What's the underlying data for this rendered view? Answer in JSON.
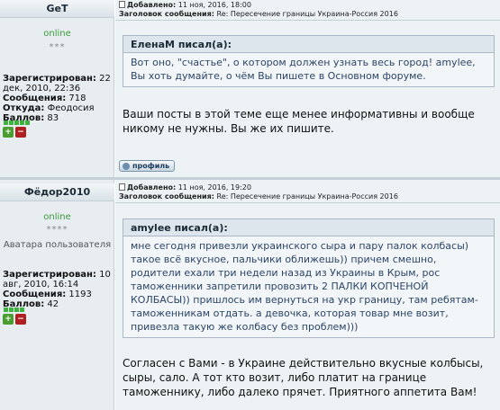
{
  "posts": [
    {
      "username": "GeT",
      "status": "online",
      "rank_stars": "***",
      "registered_label": "Зарегистрирован:",
      "registered_value": "22 дек, 2010, 22:36",
      "messages_label": "Сообщения:",
      "messages_value": "718",
      "from_label": "Откуда:",
      "from_value": "Феодосия",
      "points_label": "Баллов:",
      "points_value": "83",
      "added_label": "Добавлено:",
      "added_value": "11 ноя, 2016, 18:00",
      "subject_label": "Заголовок сообщения:",
      "subject_value": "Re: Пересечение границы Украина-Россия 2016",
      "quote_author": "ЕленаМ писал(а):",
      "quote_text": "Вот оно, \"счастье\", о котором должен узнать весь город! amylee, Вы хоть думайте, о чём Вы пишете в Основном форуме.",
      "text": "Ваши посты в этой теме еще менее информативны и вообще никому не нужны. Вы же их пишите.",
      "profile_label": "профиль"
    },
    {
      "username": "Фёдор2010",
      "status": "online",
      "rank_stars": "****",
      "avatar_alt": "Аватара пользователя",
      "registered_label": "Зарегистрирован:",
      "registered_value": "10 авг, 2010, 16:14",
      "messages_label": "Сообщения:",
      "messages_value": "1193",
      "points_label": "Баллов:",
      "points_value": "42",
      "added_label": "Добавлено:",
      "added_value": "11 ноя, 2016, 19:20",
      "subject_label": "Заголовок сообщения:",
      "subject_value": "Re: Пересечение границы Украина-Россия 2016",
      "quote_author": "amylee писал(а):",
      "quote_text": "мне сегодня привезли украинского сыра и пару палок колбасы) такое всё вкусное, пальчики оближешь)) причем смешно, родители ехали три недели назад из Украины в Крым, рос таможенники запретили провозить 2 ПАЛКИ КОПЧЕНОЙ КОЛБАСЫ)) пришлось им вернуться на укр границу, там ребятам-таможенникам отдать. а девочка, которая товар мне возит, привезла такую же колбасу без проблем)))",
      "text": "Согласен с Вами - в Украине действительно вкусные колбысы, сыры, сало. А тот кто возит, либо платит на границе таможеннику, либо далеко прячет. Приятного аппетита Вам!"
    }
  ],
  "colors": {
    "online": "#3a9a3a",
    "quote_text": "#2a4466",
    "rep_square": "#3db23d",
    "vote_up": "#4a9e2f",
    "vote_down": "#b02020"
  },
  "icons": [
    "post-doc-icon",
    "thumb-up-icon",
    "thumb-down-icon",
    "profile-icon"
  ]
}
